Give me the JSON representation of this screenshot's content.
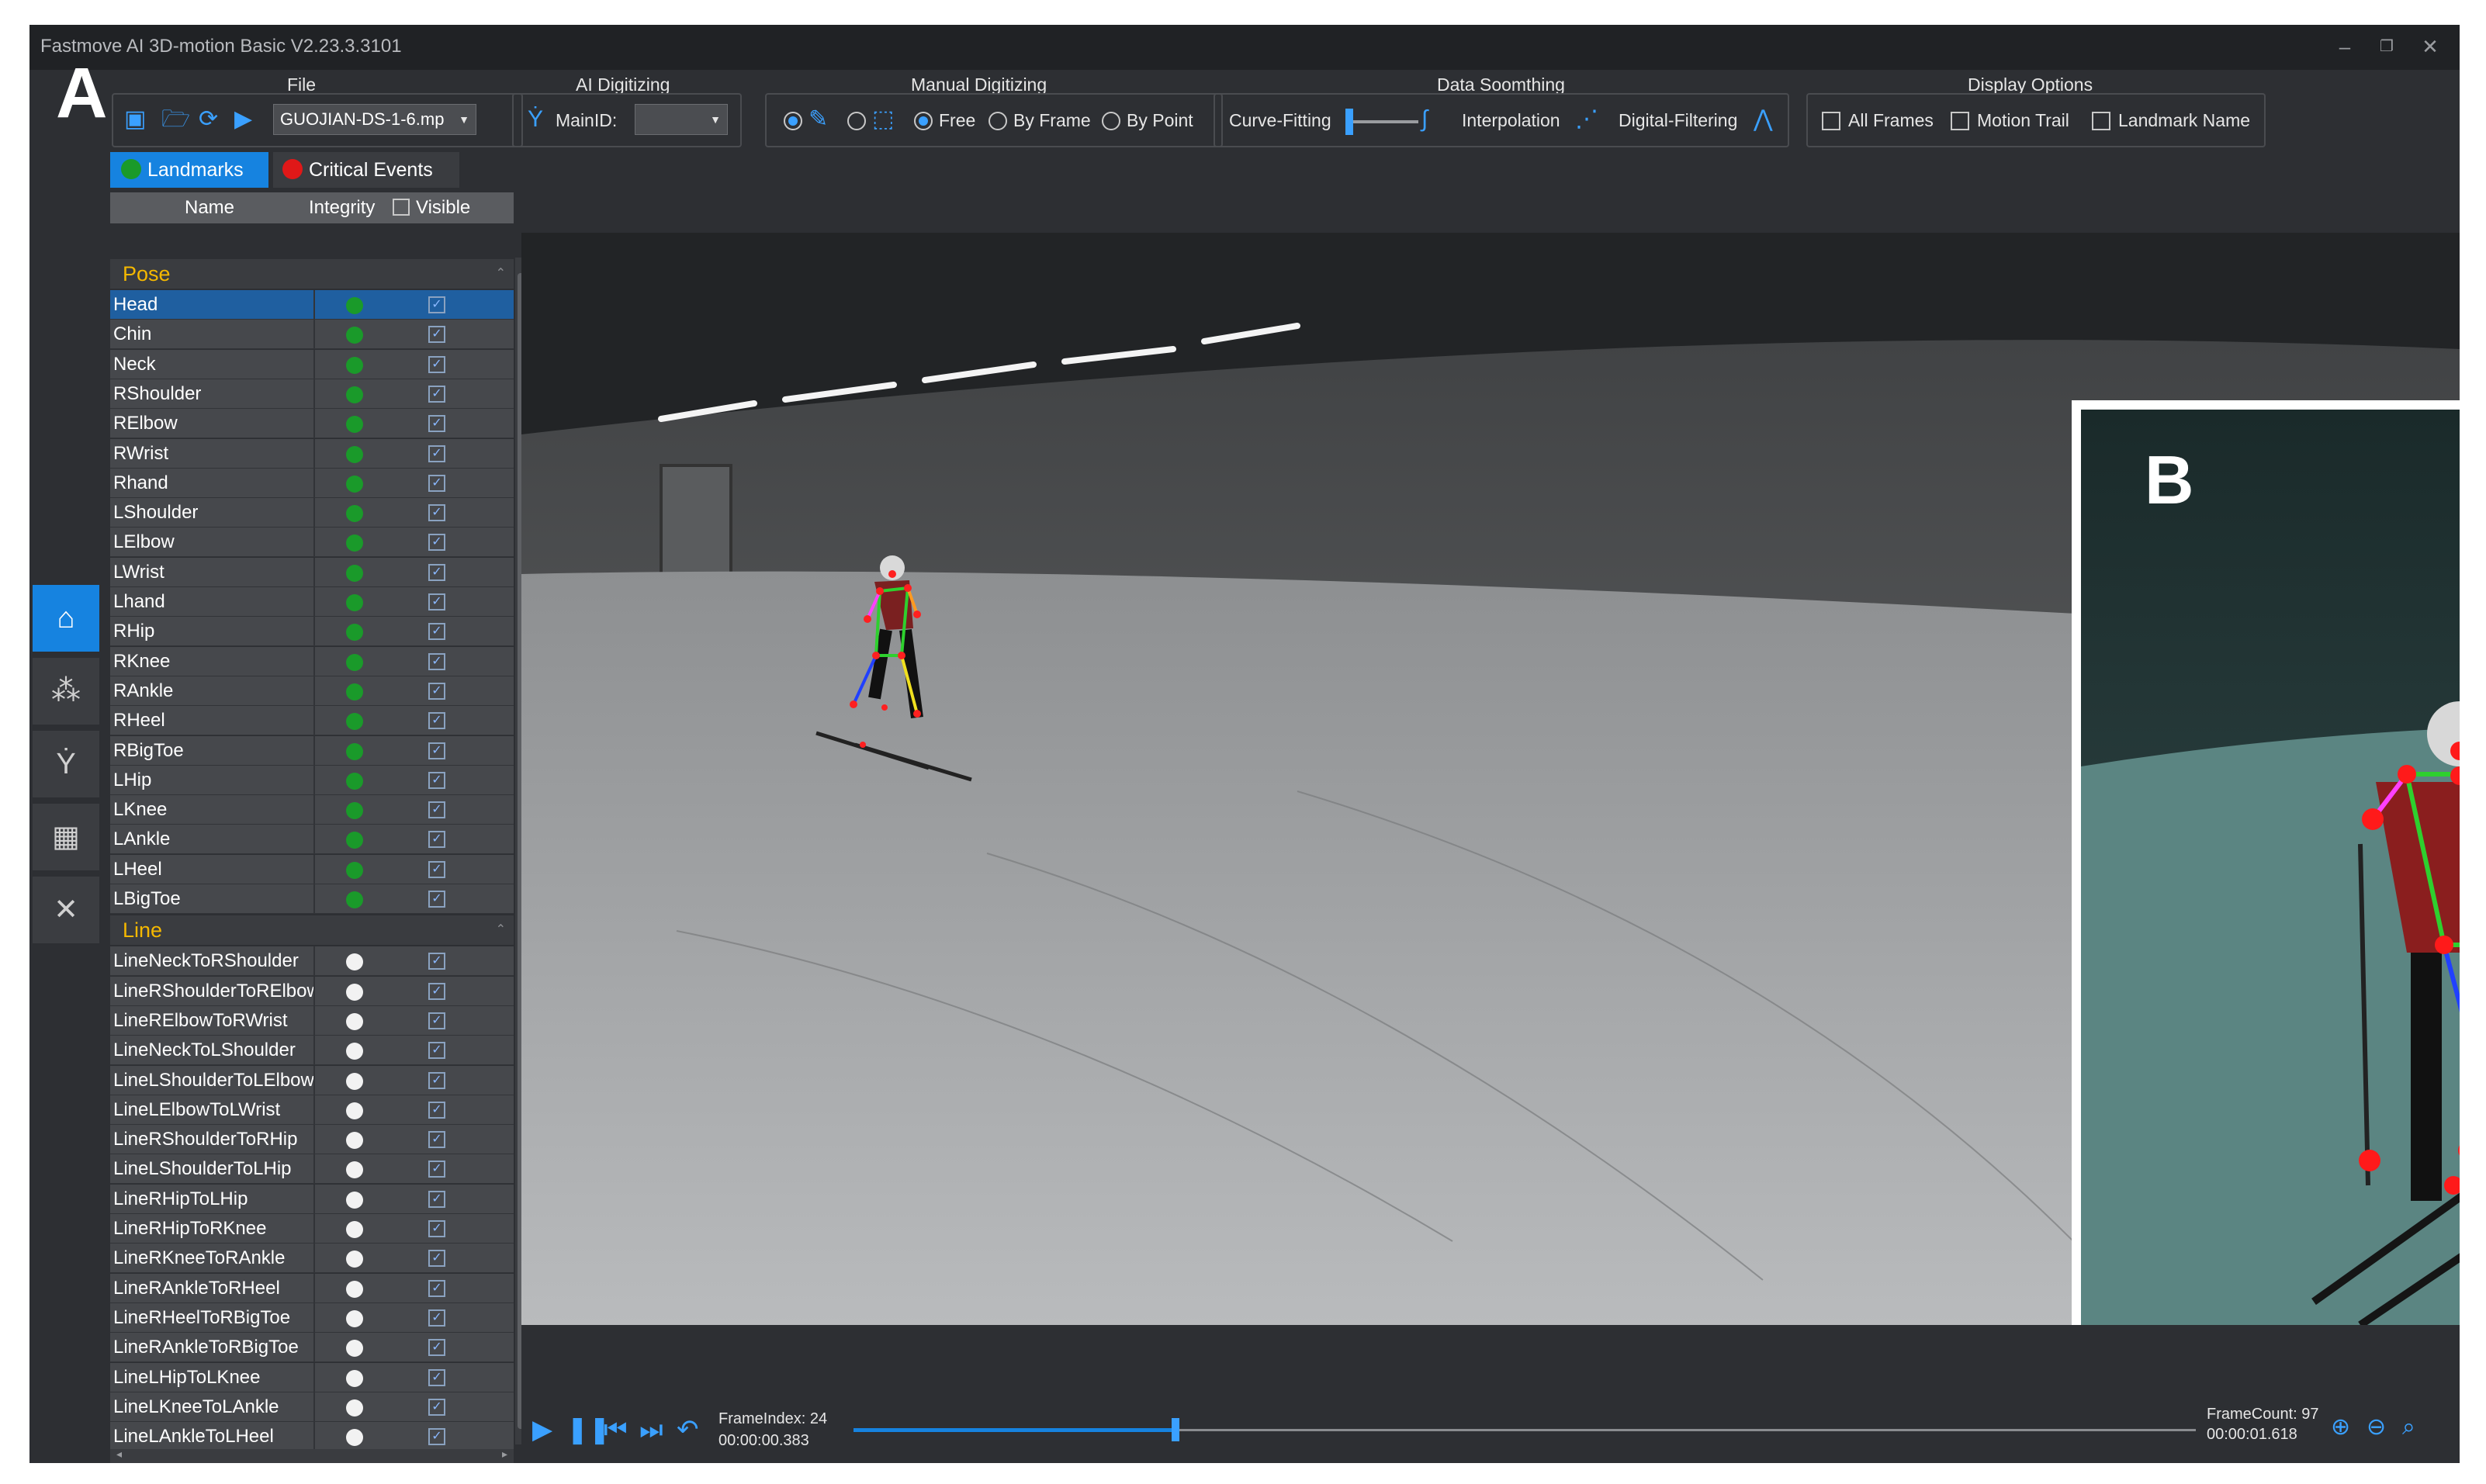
{
  "window": {
    "title": "Fastmove AI 3D-motion Basic V2.23.3.3101"
  },
  "figure_labels": {
    "a": "A",
    "b": "B"
  },
  "toolbar": {
    "file": {
      "label": "File",
      "filename": "GUOJIAN-DS-1-6.mp"
    },
    "ai": {
      "label": "AI Digitizing",
      "mainid_label": "MainID:",
      "mainid_value": ""
    },
    "manual": {
      "label": "Manual Digitizing",
      "opt_free": "Free",
      "opt_byframe": "By Frame",
      "opt_bypoint": "By Point",
      "selected": "Free"
    },
    "smoothing": {
      "label": "Data Soomthing",
      "curve": "Curve-Fitting",
      "interp": "Interpolation",
      "digital": "Digital-Filtering"
    },
    "display": {
      "label": "Display Options",
      "all_frames": "All Frames",
      "motion_trail": "Motion Trail",
      "landmark_name": "Landmark Name"
    }
  },
  "panel": {
    "tab_landmarks": "Landmarks",
    "tab_events": "Critical Events",
    "col_name": "Name",
    "col_integrity": "Integrity",
    "col_visible": "Visible",
    "pose_section": "Pose",
    "line_section": "Line",
    "pose_items": [
      "Head",
      "Chin",
      "Neck",
      "RShoulder",
      "RElbow",
      "RWrist",
      "Rhand",
      "LShoulder",
      "LElbow",
      "LWrist",
      "Lhand",
      "RHip",
      "RKnee",
      "RAnkle",
      "RHeel",
      "RBigToe",
      "LHip",
      "LKnee",
      "LAnkle",
      "LHeel",
      "LBigToe"
    ],
    "line_items": [
      "LineNeckToRShoulder",
      "LineRShoulderToRElbow",
      "LineRElbowToRWrist",
      "LineNeckToLShoulder",
      "LineLShoulderToLElbow",
      "LineLElbowToLWrist",
      "LineRShoulderToRHip",
      "LineLShoulderToLHip",
      "LineRHipToLHip",
      "LineRHipToRKnee",
      "LineRKneeToRAnkle",
      "LineRAnkleToRHeel",
      "LineRHeelToRBigToe",
      "LineRAnkleToRBigToe",
      "LineLHipToLKnee",
      "LineLKneeToLAnkle",
      "LineLAnkleToLHeel"
    ],
    "selected_item": "Head",
    "integrity_color_pose": "#1a9a2a",
    "integrity_color_line": "#f2f2f2"
  },
  "playback": {
    "frame_index_label": "FrameIndex: 24",
    "frame_time": "00:00:00.383",
    "frame_count_label": "FrameCount: 97",
    "total_time": "00:00:01.618",
    "progress": 0.24
  },
  "colors": {
    "accent": "#1683e0",
    "events_dot": "#e01818",
    "landmarks_dot": "#1a9a2a"
  }
}
